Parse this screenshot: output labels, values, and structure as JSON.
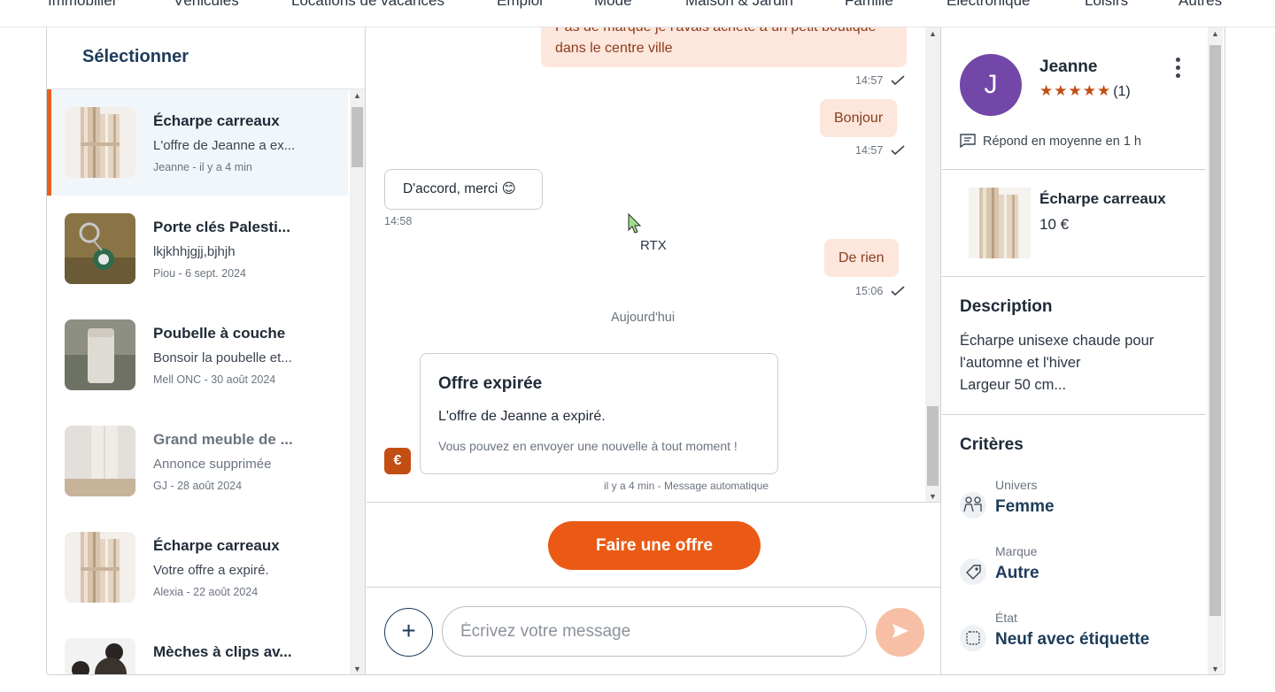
{
  "top_nav": [
    "Immobilier",
    "Véhicules",
    "Locations de vacances",
    "Emploi",
    "Mode",
    "Maison & Jardin",
    "Famille",
    "Électronique",
    "Loisirs",
    "Autres"
  ],
  "sidebar": {
    "title": "Sélectionner",
    "conversations": [
      {
        "title": "Écharpe carreaux",
        "snippet": "L'offre de Jeanne a ex...",
        "meta": "Jeanne - il y a 4 min",
        "active": true,
        "deleted": false
      },
      {
        "title": "Porte clés Palesti...",
        "snippet": "lkjkhhjgjj,bjhjh",
        "meta": "Piou - 6 sept. 2024",
        "active": false,
        "deleted": false
      },
      {
        "title": "Poubelle à couche",
        "snippet": "Bonsoir la poubelle et...",
        "meta": "Mell ONC - 30 août 2024",
        "active": false,
        "deleted": false
      },
      {
        "title": "Grand meuble de ...",
        "snippet": "Annonce supprimée",
        "meta": "GJ - 28 août 2024",
        "active": false,
        "deleted": true
      },
      {
        "title": "Écharpe carreaux",
        "snippet": "Votre offre a expiré.",
        "meta": "Alexia - 22 août 2024",
        "active": false,
        "deleted": false
      },
      {
        "title": "Mèches à clips av...",
        "snippet": "",
        "meta": "",
        "active": false,
        "deleted": false
      }
    ]
  },
  "chat": {
    "msg1_line1": "Pas de marque je l'avais acheté à un petit boutique",
    "msg1_line2": "dans le centre ville",
    "msg1_time": "14:57",
    "msg2": "Bonjour",
    "msg2_time": "14:57",
    "msg3": "D'accord, merci 😊",
    "msg3_time": "14:58",
    "cursor_label": "RTX",
    "msg4": "De rien",
    "msg4_time": "15:06",
    "day_separator": "Aujourd'hui",
    "offer_card": {
      "title": "Offre expirée",
      "body": "L'offre de Jeanne a expiré.",
      "note": "Vous pouvez en envoyer une nouvelle à tout moment !",
      "footer": "il y a 4 min - Message automatique",
      "icon": "€"
    },
    "make_offer_label": "Faire une offre",
    "compose_placeholder": "Écrivez votre message"
  },
  "seller": {
    "initial": "J",
    "name": "Jeanne",
    "stars": "★★★★★",
    "rating_count": "(1)",
    "response": "Répond en moyenne en 1 h"
  },
  "product": {
    "title": "Écharpe carreaux",
    "price": "10 €"
  },
  "description": {
    "title": "Description",
    "line1": "Écharpe unisexe chaude pour",
    "line2": "l'automne et l'hiver",
    "line3": "Largeur 50 cm..."
  },
  "criteria": {
    "title": "Critères",
    "items": [
      {
        "label": "Univers",
        "value": "Femme",
        "icon": "people-icon"
      },
      {
        "label": "Marque",
        "value": "Autre",
        "icon": "tag-icon"
      },
      {
        "label": "État",
        "value": "Neuf avec étiquette",
        "icon": "badge-icon"
      }
    ]
  },
  "colors": {
    "accent": "#ea5a14",
    "navy": "#1d3c5a",
    "bubble_me": "#fde6dc",
    "avatar": "#7347a8"
  }
}
